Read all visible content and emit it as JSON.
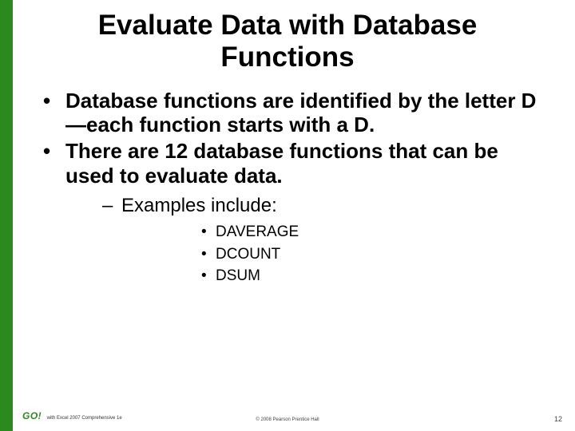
{
  "title": "Evaluate Data with Database Functions",
  "bullets": {
    "b1": "Database functions are identified by the letter D—each function starts with a D.",
    "b2": "There are 12 database functions that can be used to evaluate data.",
    "sub1": "Examples include:",
    "ex1": "DAVERAGE",
    "ex2": "DCOUNT",
    "ex3": "DSUM"
  },
  "footer": {
    "logo_text": "GO!",
    "logo_sub": "with Excel 2007 Comprehensive 1e",
    "copyright": "© 2008 Pearson Prentice Hall",
    "page": "12"
  },
  "colors": {
    "accent": "#2b8a1d"
  }
}
